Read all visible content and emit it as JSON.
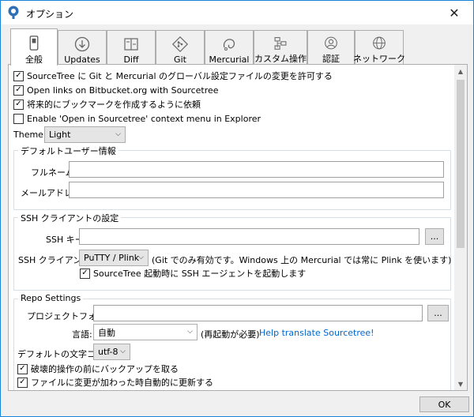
{
  "window": {
    "title": "オプション"
  },
  "tabs": [
    {
      "label": "全般",
      "icon": "switch-icon",
      "active": true
    },
    {
      "label": "Updates",
      "icon": "download-icon"
    },
    {
      "label": "Diff",
      "icon": "diff-icon"
    },
    {
      "label": "Git",
      "icon": "git-icon"
    },
    {
      "label": "Mercurial",
      "icon": "mercurial-icon"
    },
    {
      "label": "カスタム操作",
      "icon": "custom-actions-icon"
    },
    {
      "label": "認証",
      "icon": "account-icon"
    },
    {
      "label": "ネットワーク",
      "icon": "globe-icon"
    }
  ],
  "general": {
    "checkboxes": [
      {
        "label": "SourceTree に Git と Mercurial のグローバル設定ファイルの変更を許可する",
        "checked": true
      },
      {
        "label": "Open links on Bitbucket.org with Sourcetree",
        "checked": true
      },
      {
        "label": "将来的にブックマークを作成するように依頼",
        "checked": true
      },
      {
        "label": "Enable 'Open in Sourcetree' context menu in Explorer",
        "checked": false
      }
    ],
    "theme_label": "Theme:",
    "theme_value": "Light"
  },
  "default_user": {
    "title": "デフォルトユーザー情報",
    "fullname_label": "フルネーム:",
    "fullname_value": "",
    "email_label": "メールアドレス:",
    "email_value": ""
  },
  "ssh": {
    "title": "SSH クライアントの設定",
    "key_label": "SSH キー:",
    "key_value": "",
    "browse_label": "...",
    "client_label": "SSH クライアント:",
    "client_value": "PuTTY / Plink",
    "client_note": "(Git でのみ有効です。Windows 上の Mercurial では常に Plink を使います)",
    "agent_label": "SourceTree 起動時に SSH エージェントを起動します",
    "agent_checked": true
  },
  "repo": {
    "title": "Repo Settings",
    "project_folder_label": "プロジェクトフォルダ:",
    "project_folder_value": "",
    "browse_label": "...",
    "language_label": "言語:",
    "language_value": "自動",
    "restart_note": "(再起動が必要)",
    "translate_link": "Help translate Sourcetree!",
    "encoding_label": "デフォルトの文字コード:",
    "encoding_value": "utf-8",
    "backup_label": "破壊的操作の前にバックアップを取る",
    "backup_checked": true,
    "autorefresh_label": "ファイルに変更が加わった時自動的に更新する",
    "autorefresh_checked": true
  },
  "footer": {
    "ok_label": "OK"
  },
  "colors": {
    "accent": "#1883d7",
    "link": "#0066cc",
    "app_icon": "#2e6fb5"
  }
}
